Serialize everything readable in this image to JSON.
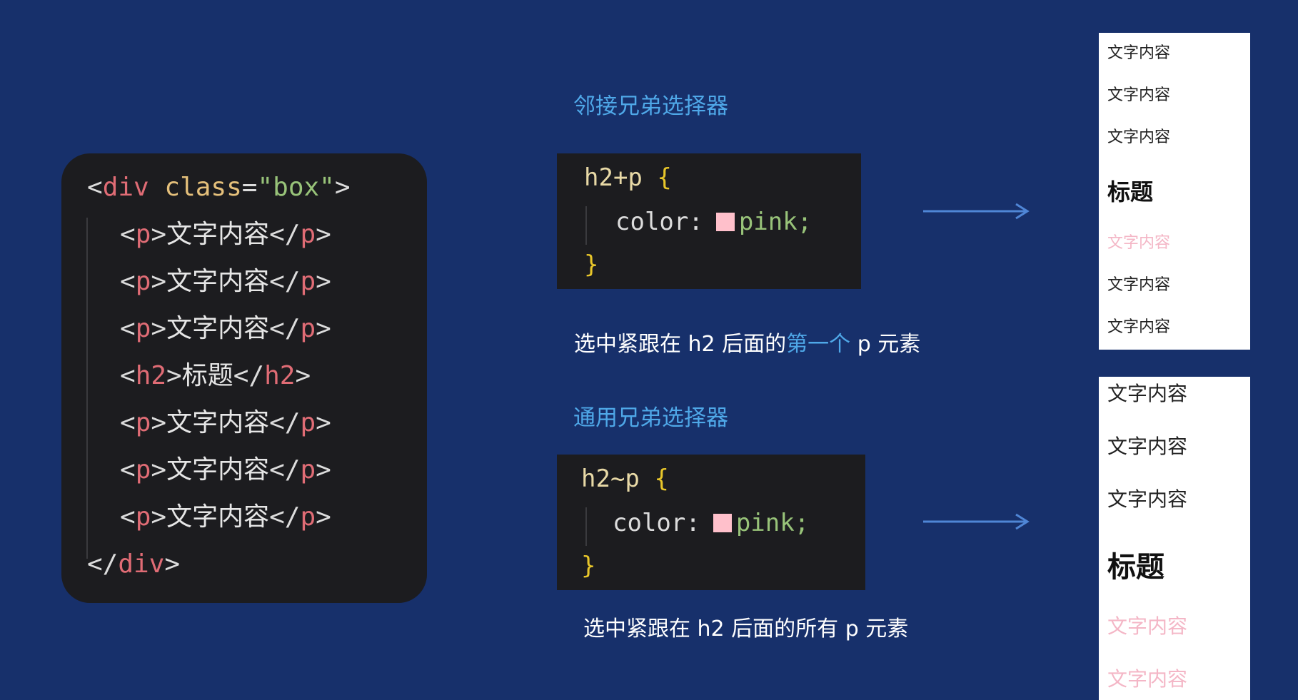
{
  "html_code": {
    "open_div": {
      "lt": "<",
      "tag": "div",
      "attr": "class",
      "eq": "=",
      "value": "\"box\"",
      "gt": ">"
    },
    "p_text": "文字内容",
    "h2_text": "标题",
    "tag_p": "p",
    "tag_h2": "h2",
    "close_div_tag": "div"
  },
  "adjacent": {
    "title": "邻接兄弟选择器",
    "selector": "h2+p",
    "open_brace": "{",
    "property": "color:",
    "value": "pink;",
    "close_brace": "}",
    "description_before": "选中紧跟在 h2 后面的",
    "description_highlight": "第一个",
    "description_after": " p 元素"
  },
  "general": {
    "title": "通用兄弟选择器",
    "selector": "h2~p",
    "open_brace": "{",
    "property": "color:",
    "value": "pink;",
    "close_brace": "}",
    "description": "选中紧跟在 h2 后面的所有 p 元素"
  },
  "preview_adjacent": {
    "lines": [
      "文字内容",
      "文字内容",
      "文字内容",
      "标题",
      "文字内容",
      "文字内容",
      "文字内容"
    ]
  },
  "preview_general": {
    "lines": [
      "文字内容",
      "文字内容",
      "文字内容",
      "标题",
      "文字内容",
      "文字内容"
    ]
  },
  "colors": {
    "background": "#17306b",
    "panel": "#1c1c1f",
    "tag": "#e06c75",
    "attribute": "#e5c07b",
    "string": "#98c379",
    "title_blue": "#4fa8e8",
    "pink": "#ffc0cb"
  }
}
